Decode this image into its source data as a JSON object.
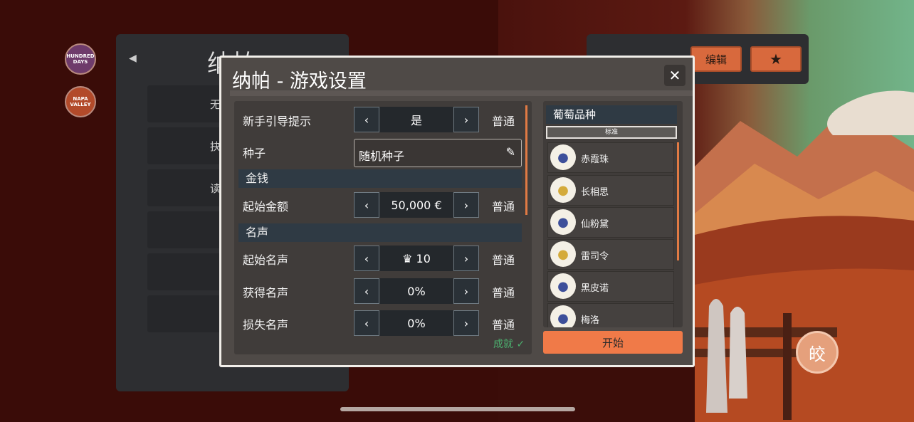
{
  "sidebar": {
    "badge_hundred_days": "HUNDRED DAYS",
    "badge_napa_valley": "NAPA VALLEY"
  },
  "background_panel": {
    "title": "纳帕",
    "rows": [
      "无",
      "抉",
      "读"
    ]
  },
  "top_right": {
    "edit_label": "编辑",
    "star_icon": "star-icon"
  },
  "dialog": {
    "title": "纳帕 - 游戏设置",
    "close_icon": "close-icon",
    "settings": {
      "tutorial": {
        "label": "新手引导提示",
        "value": "是",
        "tag": "普通"
      },
      "seed": {
        "label": "种子",
        "value": "随机种子"
      },
      "money_section": "金钱",
      "start_money": {
        "label": "起始金额",
        "value": "50,000 €",
        "tag": "普通"
      },
      "fame_section": "名声",
      "start_fame": {
        "label": "起始名声",
        "value": "♛ 10",
        "tag": "普通"
      },
      "gain_fame": {
        "label": "获得名声",
        "value": "0%",
        "tag": "普通"
      },
      "lose_fame": {
        "label": "损失名声",
        "value": "0%",
        "tag": "普通"
      }
    },
    "done_label": "成就 ✓",
    "grapes": {
      "header": "葡萄品种",
      "standard": "标准",
      "items": [
        {
          "name": "赤霞珠",
          "color": "blue"
        },
        {
          "name": "长相思",
          "color": "gold"
        },
        {
          "name": "仙粉黛",
          "color": "blue"
        },
        {
          "name": "雷司令",
          "color": "gold"
        },
        {
          "name": "黑皮诺",
          "color": "blue"
        },
        {
          "name": "梅洛",
          "color": "blue"
        }
      ]
    },
    "start_label": "开始"
  },
  "circle_button": "皎",
  "colors": {
    "accent": "#f07a48",
    "dialog_bg": "#4f4a47",
    "done_green": "#4caf6e"
  }
}
